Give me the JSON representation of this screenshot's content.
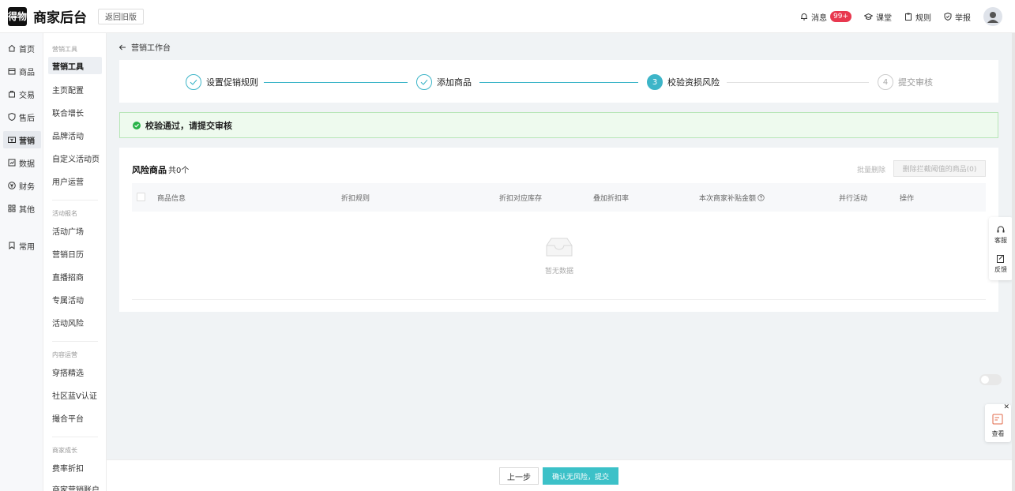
{
  "header": {
    "logo_text": "得物",
    "brand": "商家后台",
    "old_version": "返回旧版",
    "messages": "消息",
    "messages_badge": "99+",
    "classroom": "课堂",
    "rules": "规则",
    "report": "举报"
  },
  "rail": {
    "items": [
      "首页",
      "商品",
      "交易",
      "售后",
      "营销",
      "数据",
      "财务",
      "其他",
      "常用"
    ]
  },
  "sub": {
    "group1": "营销工具",
    "g1_items": [
      "营销工具",
      "主页配置",
      "联合增长",
      "品牌活动",
      "自定义活动页",
      "用户运营"
    ],
    "group2": "活动报名",
    "g2_items": [
      "活动广场",
      "营销日历",
      "直播招商",
      "专属活动",
      "活动风险"
    ],
    "group3": "内容运营",
    "g3_items": [
      "穿搭精选",
      "社区蓝V认证",
      "撮合平台"
    ],
    "group4": "商家成长",
    "g4_items": [
      "费率折扣",
      "商家营销账户"
    ]
  },
  "crumb": "营销工作台",
  "steps": [
    {
      "label": "设置促销规则",
      "num": "1"
    },
    {
      "label": "添加商品",
      "num": "2"
    },
    {
      "label": "校验资损风险",
      "num": "3"
    },
    {
      "label": "提交审核",
      "num": "4"
    }
  ],
  "success_msg": "校验通过，请提交审核",
  "risk": {
    "title": "风险商品",
    "count": "共0个",
    "bulk_delete": "批量删除",
    "delete_btn": "删除拦截阈值的商品(0)",
    "columns": [
      "商品信息",
      "折扣规则",
      "折扣对应库存",
      "叠加折扣率",
      "本次商家补贴金额",
      "并行活动",
      "操作"
    ],
    "empty": "暂无数据"
  },
  "footer": {
    "prev": "上一步",
    "submit": "确认无风险，提交"
  },
  "float": {
    "service": "客服",
    "feedback": "反馈",
    "view": "查看"
  },
  "colors": {
    "accent": "#3db5c8",
    "submit": "#3cc1c8",
    "success": "#28b248",
    "badge": "#e8384f"
  }
}
